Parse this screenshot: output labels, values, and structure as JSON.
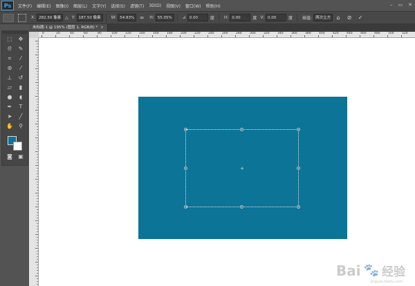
{
  "app": {
    "logo": "Ps"
  },
  "menu": [
    "文件(F)",
    "编辑(E)",
    "图像(I)",
    "图层(L)",
    "文字(Y)",
    "选择(S)",
    "滤镜(T)",
    "3D(D)",
    "视图(V)",
    "窗口(W)",
    "帮助(H)"
  ],
  "window_controls": [
    "–",
    "▭",
    "✕"
  ],
  "options": {
    "x_label": "X:",
    "x_value": "282.50 像素",
    "y_label": "Y:",
    "y_value": "187.50 像素",
    "w_label": "W:",
    "w_value": "54.83%",
    "link_icon": "∞",
    "h_label": "H:",
    "h_value": "55.05%",
    "angle_label": "⊿",
    "angle_value": "0.00",
    "angle_unit": "度",
    "hskew_label": "H:",
    "hskew_value": "0.00",
    "hskew_unit": "度",
    "vskew_label": "V:",
    "vskew_value": "0.00",
    "vskew_unit": "度",
    "interp_label": "插值:",
    "interp_value": "两次立方",
    "warp_icon": "⌂",
    "cancel_icon": "⊘",
    "commit_icon": "✓"
  },
  "document": {
    "tab_title": "未标题-1 @ 195% (图层 1, RGB/8) *",
    "tab_close": "×"
  },
  "ruler": {
    "top_labels": [
      "0",
      "20",
      "40",
      "60",
      "80",
      "100",
      "120",
      "140",
      "160",
      "180",
      "200",
      "220",
      "240",
      "260",
      "280",
      "300",
      "320",
      "340",
      "360",
      "380",
      "400",
      "420",
      "440",
      "460",
      "480",
      "500",
      "520",
      "540"
    ]
  },
  "colors": {
    "foreground": "#0b7497",
    "background": "#ffffff",
    "layer_fill": "#0b7497"
  },
  "watermark": {
    "brand": "Bai",
    "paw": "🐾",
    "brand2": "经验",
    "url": "jingyan.baidu.com"
  }
}
